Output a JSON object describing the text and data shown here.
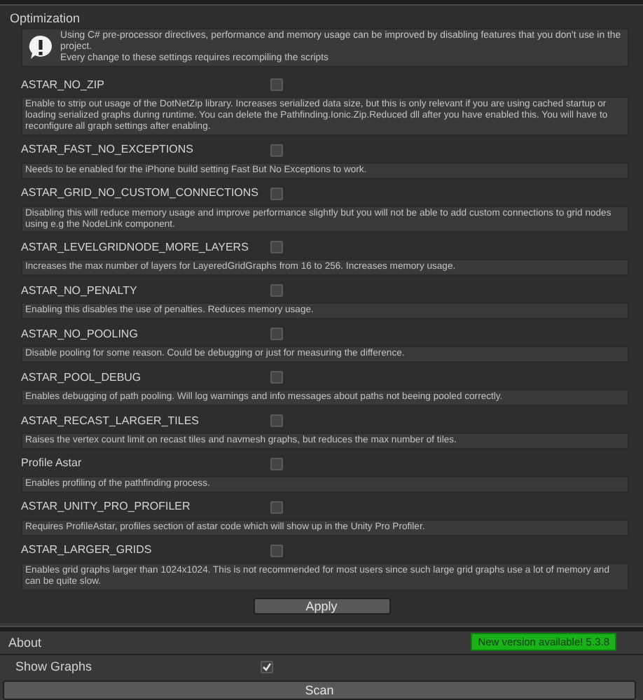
{
  "section": {
    "title": "Optimization"
  },
  "info": {
    "text": "Using C# pre-processor directives, performance and memory usage can be improved by disabling features that you don't use in the project.\nEvery change to these settings requires recompiling the scripts"
  },
  "defines": [
    {
      "name": "ASTAR_NO_ZIP",
      "checked": false,
      "description": "Enable to strip out usage of the DotNetZip library. Increases serialized data size, but this is only relevant if you are using cached startup or loading serialized graphs during runtime. You can delete the Pathfinding.Ionic.Zip.Reduced dll after you have enabled this. You will have to reconfigure all graph settings after enabling."
    },
    {
      "name": "ASTAR_FAST_NO_EXCEPTIONS",
      "checked": false,
      "description": "Needs to be enabled for the iPhone build setting Fast But No Exceptions to work."
    },
    {
      "name": "ASTAR_GRID_NO_CUSTOM_CONNECTIONS",
      "checked": false,
      "description": "Disabling this will reduce memory usage and improve performance slightly but you will not be able to add custom connections to grid nodes using e.g the NodeLink component."
    },
    {
      "name": "ASTAR_LEVELGRIDNODE_MORE_LAYERS",
      "checked": false,
      "description": "Increases the max number of layers for LayeredGridGraphs from 16 to 256. Increases memory usage."
    },
    {
      "name": "ASTAR_NO_PENALTY",
      "checked": false,
      "description": "Enabling this disables the use of penalties. Reduces memory usage."
    },
    {
      "name": "ASTAR_NO_POOLING",
      "checked": false,
      "description": "Disable pooling for some reason. Could be debugging or just for measuring the difference."
    },
    {
      "name": "ASTAR_POOL_DEBUG",
      "checked": false,
      "description": "Enables debugging of path pooling. Will log warnings and info messages about paths not beeing pooled correctly."
    },
    {
      "name": "ASTAR_RECAST_LARGER_TILES",
      "checked": false,
      "description": "Raises the vertex count limit on recast tiles and navmesh graphs, but reduces the max number of tiles."
    },
    {
      "name": "Profile Astar",
      "checked": false,
      "description": "Enables profiling of the pathfinding process."
    },
    {
      "name": "ASTAR_UNITY_PRO_PROFILER",
      "checked": false,
      "description": "Requires ProfileAstar, profiles section of astar code which will show up in the Unity Pro Profiler."
    },
    {
      "name": "ASTAR_LARGER_GRIDS",
      "checked": false,
      "description": "Enables grid graphs larger than 1024x1024. This is not recommended for most users since such large grid graphs use a lot of memory and can be quite slow."
    }
  ],
  "apply_button": "Apply",
  "about": {
    "title": "About",
    "badge": "New version available! 5.3.8"
  },
  "show_graphs": {
    "label": "Show Graphs",
    "checked": true
  },
  "scan_button": "Scan"
}
